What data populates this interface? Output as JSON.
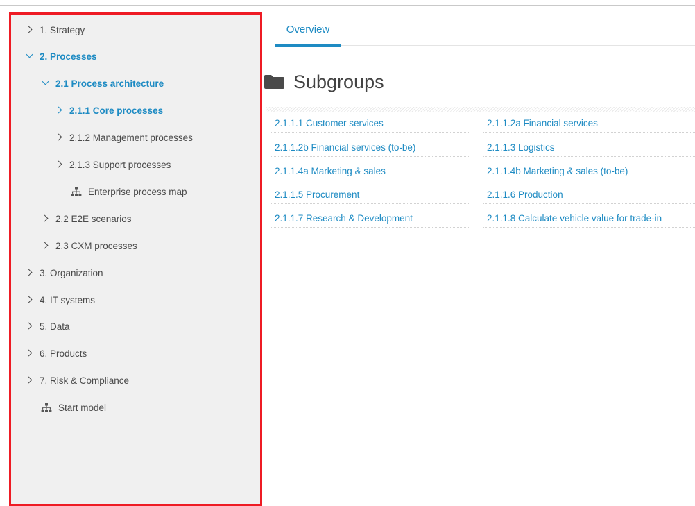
{
  "tree": {
    "strategy": "1. Strategy",
    "processes": "2. Processes",
    "process_architecture": "2.1 Process architecture",
    "core_processes": "2.1.1 Core processes",
    "management_processes": "2.1.2 Management processes",
    "support_processes": "2.1.3 Support processes",
    "enterprise_process_map": "Enterprise process map",
    "e2e_scenarios": "2.2 E2E scenarios",
    "cxm_processes": "2.3 CXM processes",
    "organization": "3. Organization",
    "it_systems": "4. IT systems",
    "data": "5. Data",
    "products": "6. Products",
    "risk_compliance": "7. Risk & Compliance",
    "start_model": "Start model"
  },
  "tabs": {
    "overview": "Overview"
  },
  "subgroups": {
    "title": "Subgroups",
    "items": [
      "2.1.1.1 Customer services",
      "2.1.1.2a Financial services",
      "2.1.1.2b Financial services (to-be)",
      "2.1.1.3 Logistics",
      "2.1.1.4a Marketing & sales",
      "2.1.1.4b Marketing & sales (to-be)",
      "2.1.1.5 Procurement",
      "2.1.1.6 Production",
      "2.1.1.7 Research & Development",
      "2.1.1.8 Calculate vehicle value for trade-in"
    ]
  },
  "colors": {
    "accent": "#1e8bc3",
    "highlight_border": "#ee1b24",
    "sidebar_bg": "#f0f0f0"
  },
  "icons": {
    "expand": "chevron-right-icon",
    "collapse": "chevron-down-icon",
    "model": "model-diagram-icon",
    "folder": "folder-icon"
  }
}
